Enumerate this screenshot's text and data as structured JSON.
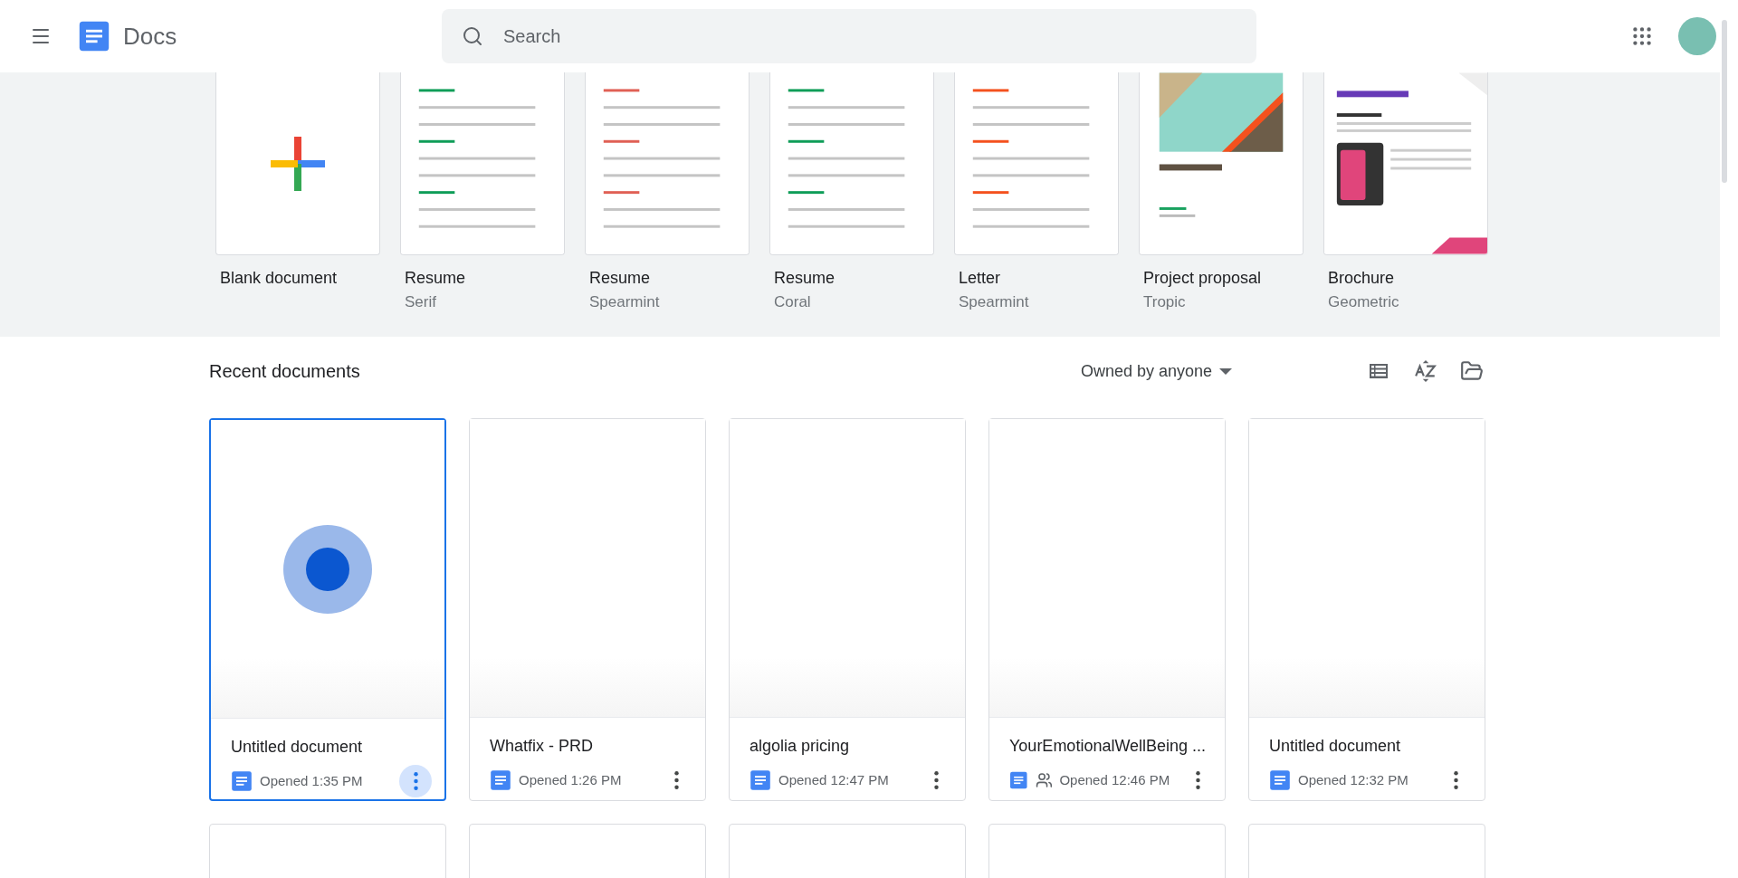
{
  "header": {
    "app_name": "Docs",
    "search": {
      "placeholder": "Search"
    }
  },
  "templates": [
    {
      "kind": "blank",
      "name": "Blank document"
    },
    {
      "kind": "template",
      "name": "Resume",
      "subtitle": "Serif"
    },
    {
      "kind": "template",
      "name": "Resume",
      "subtitle": "Spearmint"
    },
    {
      "kind": "template",
      "name": "Resume",
      "subtitle": "Coral"
    },
    {
      "kind": "template",
      "name": "Letter",
      "subtitle": "Spearmint"
    },
    {
      "kind": "template",
      "name": "Project proposal",
      "subtitle": "Tropic"
    },
    {
      "kind": "template",
      "name": "Brochure",
      "subtitle": "Geometric"
    }
  ],
  "recent": {
    "title": "Recent documents",
    "owner_filter": "Owned by anyone",
    "documents": [
      {
        "title": "Untitled document",
        "opened": "Opened 1:35 PM",
        "shared": false,
        "selected": true
      },
      {
        "title": "Whatfix - PRD",
        "opened": "Opened 1:26 PM",
        "shared": false,
        "selected": false
      },
      {
        "title": "algolia pricing",
        "opened": "Opened 12:47 PM",
        "shared": false,
        "selected": false
      },
      {
        "title": "YourEmotionalWellBeing ...",
        "opened": "Opened 12:46 PM",
        "shared": true,
        "selected": false
      },
      {
        "title": "Untitled document",
        "opened": "Opened 12:32 PM",
        "shared": false,
        "selected": false
      }
    ]
  }
}
